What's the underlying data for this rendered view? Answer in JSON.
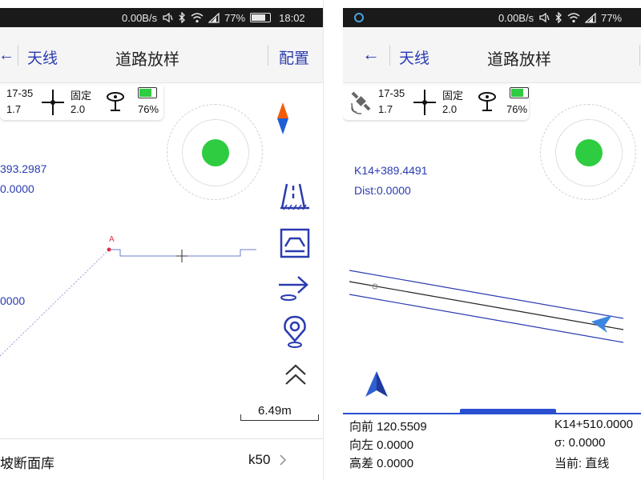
{
  "status_left": {
    "net_speed": "0.00B/s",
    "battery": "77%",
    "battery_level": 0.77,
    "time": "18:02"
  },
  "status_right": {
    "net_speed": "0.00B/s",
    "battery": "77%",
    "battery_level": 0.77
  },
  "left": {
    "header": {
      "back_label": "天线",
      "title": "道路放样",
      "config_label": "配置"
    },
    "info": {
      "sats": "17-35",
      "pdop": "1.7",
      "fix_label": "固定",
      "fix_value": "2.0",
      "battery": "76%",
      "battery_level": 0.76
    },
    "station": "393.2987",
    "dist": "0.0000",
    "value3": "0000",
    "point_label": "A",
    "scale": "6.49m",
    "bottom": {
      "label": "坡断面库",
      "value": "k50"
    }
  },
  "right": {
    "header": {
      "back_label": "天线",
      "title": "道路放样"
    },
    "info": {
      "sats": "17-35",
      "pdop": "1.7",
      "fix_label": "固定",
      "fix_value": "2.0",
      "battery": "76%",
      "battery_level": 0.76
    },
    "station": "K14+389.4491",
    "dist": "Dist:0.0000",
    "readouts": {
      "forward": "向前 120.5509",
      "left": "向左 0.0000",
      "height_diff": "高差 0.0000",
      "end_station": "K14+510.0000",
      "sigma": "σ: 0.0000",
      "current": "当前: 直线"
    }
  },
  "colors": {
    "accent_blue": "#2a3bb0",
    "gps_green": "#2ecc40",
    "compass_orange": "#f25c05",
    "compass_blue": "#1f5fd6",
    "status_bg": "#1a1a1a",
    "header_bg": "#f5f5f5"
  },
  "icons": [
    "wifi-icon",
    "bluetooth-icon",
    "mute-icon",
    "signal-icon",
    "battery-icon",
    "back-arrow-icon",
    "satellite-icon",
    "crosshair-icon",
    "antenna-icon",
    "compass-icon",
    "road-icon",
    "cross-section-icon",
    "stakeout-arrow-icon",
    "location-pin-icon",
    "expand-up-icon",
    "north-arrow-icon",
    "navigation-arrow-icon",
    "chevron-right-icon"
  ]
}
